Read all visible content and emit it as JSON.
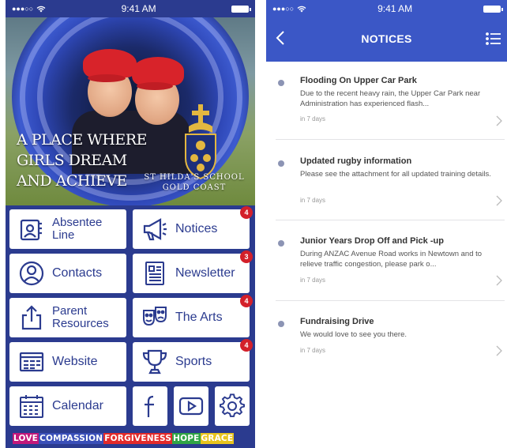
{
  "screen1": {
    "status": {
      "signal": "●●●○○",
      "time": "9:41 AM"
    },
    "hero": {
      "tagline": [
        "A PLACE WHERE",
        "GIRLS DREAM",
        "AND ACHIEVE"
      ],
      "school_name": [
        "ST HILDA'S SCHOOL",
        "GOLD COAST"
      ]
    },
    "tiles": [
      {
        "label": "Absentee Line",
        "icon": "absentee-icon",
        "badge": ""
      },
      {
        "label": "Notices",
        "icon": "megaphone-icon",
        "badge": "4"
      },
      {
        "label": "Contacts",
        "icon": "contact-icon",
        "badge": ""
      },
      {
        "label": "Newsletter",
        "icon": "newsletter-icon",
        "badge": "3"
      },
      {
        "label": "Parent Resources",
        "icon": "upload-icon",
        "badge": ""
      },
      {
        "label": "The Arts",
        "icon": "theatre-masks-icon",
        "badge": "4"
      },
      {
        "label": "Website",
        "icon": "browser-icon",
        "badge": ""
      },
      {
        "label": "Sports",
        "icon": "trophy-icon",
        "badge": "4"
      },
      {
        "label": "Calendar",
        "icon": "calendar-icon",
        "badge": ""
      }
    ],
    "social": [
      {
        "icon": "facebook-icon"
      },
      {
        "icon": "youtube-icon"
      },
      {
        "icon": "settings-gear-icon"
      }
    ],
    "values_bar": [
      {
        "word": "LOVE",
        "color": "#c2187a"
      },
      {
        "word": "COMPASSION",
        "color": "#3a4fb8"
      },
      {
        "word": "FORGIVENESS",
        "color": "#e22a2a"
      },
      {
        "word": "HOPE",
        "color": "#31a446"
      },
      {
        "word": "GRACE",
        "color": "#e8c41e"
      }
    ],
    "colors": {
      "brand_navy": "#2b3b8f",
      "badge_red": "#d3202a"
    }
  },
  "screen2": {
    "status": {
      "signal": "●●●○○",
      "time": "9:41 AM"
    },
    "nav": {
      "title": "NOTICES"
    },
    "notices": [
      {
        "title": "Flooding On Upper Car Park",
        "desc": "Due to the recent heavy rain, the Upper Car Park near Administration has experienced flash...",
        "time": "in 7 days"
      },
      {
        "title": "Updated rugby information",
        "desc": "Please see the attachment for all updated training details.",
        "time": "in 7 days"
      },
      {
        "title": "Junior Years Drop Off and Pick -up",
        "desc": "During ANZAC Avenue Road works in Newtown and to relieve traffic congestion, please park o...",
        "time": "in 7 days"
      },
      {
        "title": "Fundraising Drive",
        "desc": "We would love to see you there.",
        "time": "in 7 days"
      }
    ],
    "colors": {
      "header_blue": "#3b57c6"
    }
  }
}
